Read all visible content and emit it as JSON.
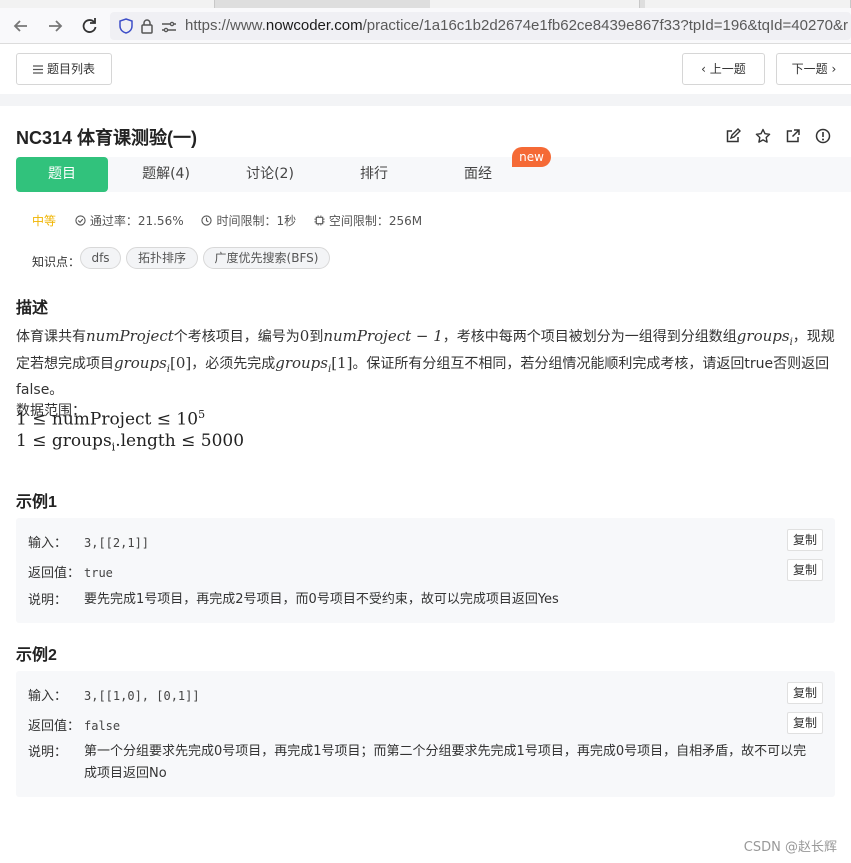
{
  "browser": {
    "url_prefix": "https://www.",
    "url_host": "nowcoder.com",
    "url_path": "/practice/1a16c1b2d2674e1fb62ce8439e867f33?tpId=196&tqId=40270&r"
  },
  "toolbar": {
    "problem_list": "题目列表",
    "prev": "上一题",
    "next": "下一题"
  },
  "problem": {
    "title": "NC314  体育课测验(一)"
  },
  "tabs": [
    {
      "label": "题目"
    },
    {
      "label": "题解(4)"
    },
    {
      "label": "讨论(2)"
    },
    {
      "label": "排行"
    },
    {
      "label": "面经"
    }
  ],
  "new_badge": "new",
  "meta": {
    "difficulty": "中等",
    "pass_rate": "通过率：21.56%",
    "time_limit": "时间限制：1秒",
    "space_limit": "空间限制：256M"
  },
  "knowledge": {
    "label": "知识点：",
    "tags": [
      "dfs",
      "拓扑排序",
      "广度优先搜索(BFS)"
    ]
  },
  "description": {
    "heading": "描述",
    "p1_a": "体育课共有",
    "p1_m1": "numProject",
    "p1_b": "个考核项目，编号为",
    "p1_m2": "0",
    "p1_c": "到",
    "p1_m3": "numProject − 1",
    "p1_d": "，考核中每两个项目被划分为一组得到分组数组",
    "p1_m4": "groups",
    "p1_m4sub": "i",
    "p1_e": "，现规定若想完成项目",
    "p1_m5": "groups",
    "p1_m5sub": "i",
    "p1_m5idx": "[0]",
    "p1_f": "，必须先完成",
    "p1_m6": "groups",
    "p1_m6sub": "i",
    "p1_m6idx": "[1]",
    "p1_g": "。保证所有分组互不相同，若分组情况能顺利完成考核，请返回true否则返回false。",
    "range_label": "数据范围：",
    "range1": "1 ≤ numProject ≤ 10",
    "range1_sup": "5",
    "range2": "1 ≤ groups",
    "range2_sub": "i",
    "range2_tail": ".length ≤ 5000"
  },
  "examples": [
    {
      "heading": "示例1",
      "input_label": "输入：",
      "input": "3,[[2,1]]",
      "output_label": "返回值：",
      "output": "true",
      "explain_label": "说明：",
      "explain": "要先完成1号项目，再完成2号项目，而0号项目不受约束，故可以完成项目返回Yes",
      "copy": "复制"
    },
    {
      "heading": "示例2",
      "input_label": "输入：",
      "input": "3,[[1,0], [0,1]]",
      "output_label": "返回值：",
      "output": "false",
      "explain_label": "说明：",
      "explain": "第一个分组要求先完成0号项目，再完成1号项目；而第二个分组要求先完成1号项目，再完成0号项目，自相矛盾，故不可以完成项目返回No",
      "copy": "复制"
    }
  ],
  "watermark": "CSDN @赵长辉"
}
